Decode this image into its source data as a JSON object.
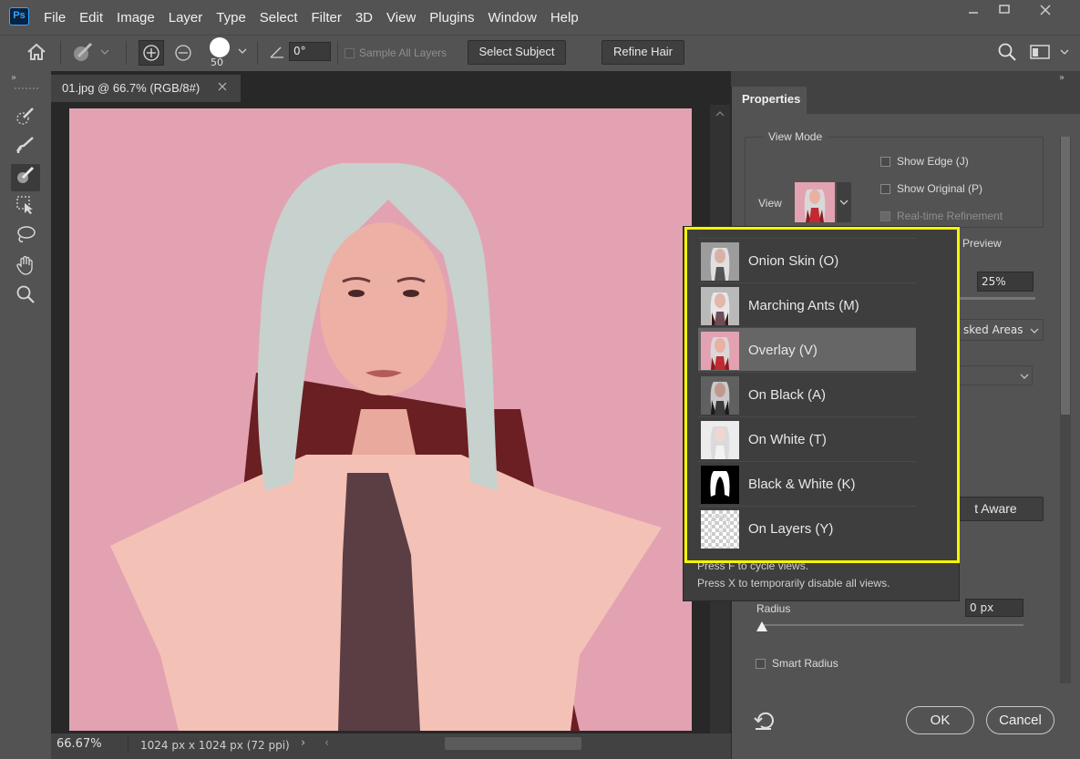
{
  "app": {
    "logo_text": "Ps",
    "menu": [
      "File",
      "Edit",
      "Image",
      "Layer",
      "Type",
      "Select",
      "Filter",
      "3D",
      "View",
      "Plugins",
      "Window",
      "Help"
    ]
  },
  "options_bar": {
    "brush_size": "50",
    "angle_value": "0°",
    "sample_all_layers_label": "Sample All Layers",
    "select_subject_label": "Select Subject",
    "refine_hair_label": "Refine Hair"
  },
  "document": {
    "tab_title": "01.jpg @ 66.7% (RGB/8#)",
    "zoom": "66.67%",
    "size_info": "1024 px x 1024 px (72 ppi)"
  },
  "properties": {
    "tab_label": "Properties",
    "view_mode_label": "View Mode",
    "view_label": "View",
    "show_edge_label": "Show Edge (J)",
    "show_original_label": "Show Original (P)",
    "realtime_label": "Real-time Refinement",
    "preview_label": "Preview",
    "opacity_value": "25%",
    "masked_areas_partial": "sked Areas",
    "content_aware_partial": "t Aware",
    "radius_label": "Radius",
    "radius_value": "0 px",
    "smart_radius_label": "Smart Radius",
    "ok_label": "OK",
    "cancel_label": "Cancel"
  },
  "view_modes": [
    {
      "label": "Onion Skin (O)",
      "thumb": "onion-skin"
    },
    {
      "label": "Marching Ants (M)",
      "thumb": "marching-ants"
    },
    {
      "label": "Overlay (V)",
      "thumb": "overlay"
    },
    {
      "label": "On Black (A)",
      "thumb": "on-black"
    },
    {
      "label": "On White (T)",
      "thumb": "on-white"
    },
    {
      "label": "Black & White (K)",
      "thumb": "black-white"
    },
    {
      "label": "On Layers (Y)",
      "thumb": "on-layers"
    }
  ],
  "view_mode_selected": "Overlay (V)",
  "view_mode_hints": [
    "Press F to cycle views.",
    "Press X to temporarily disable all views."
  ],
  "colors": {
    "overlay_pink": "#e3a2b1",
    "highlight_yellow": "#f5f500",
    "panel_bg": "#535353"
  }
}
